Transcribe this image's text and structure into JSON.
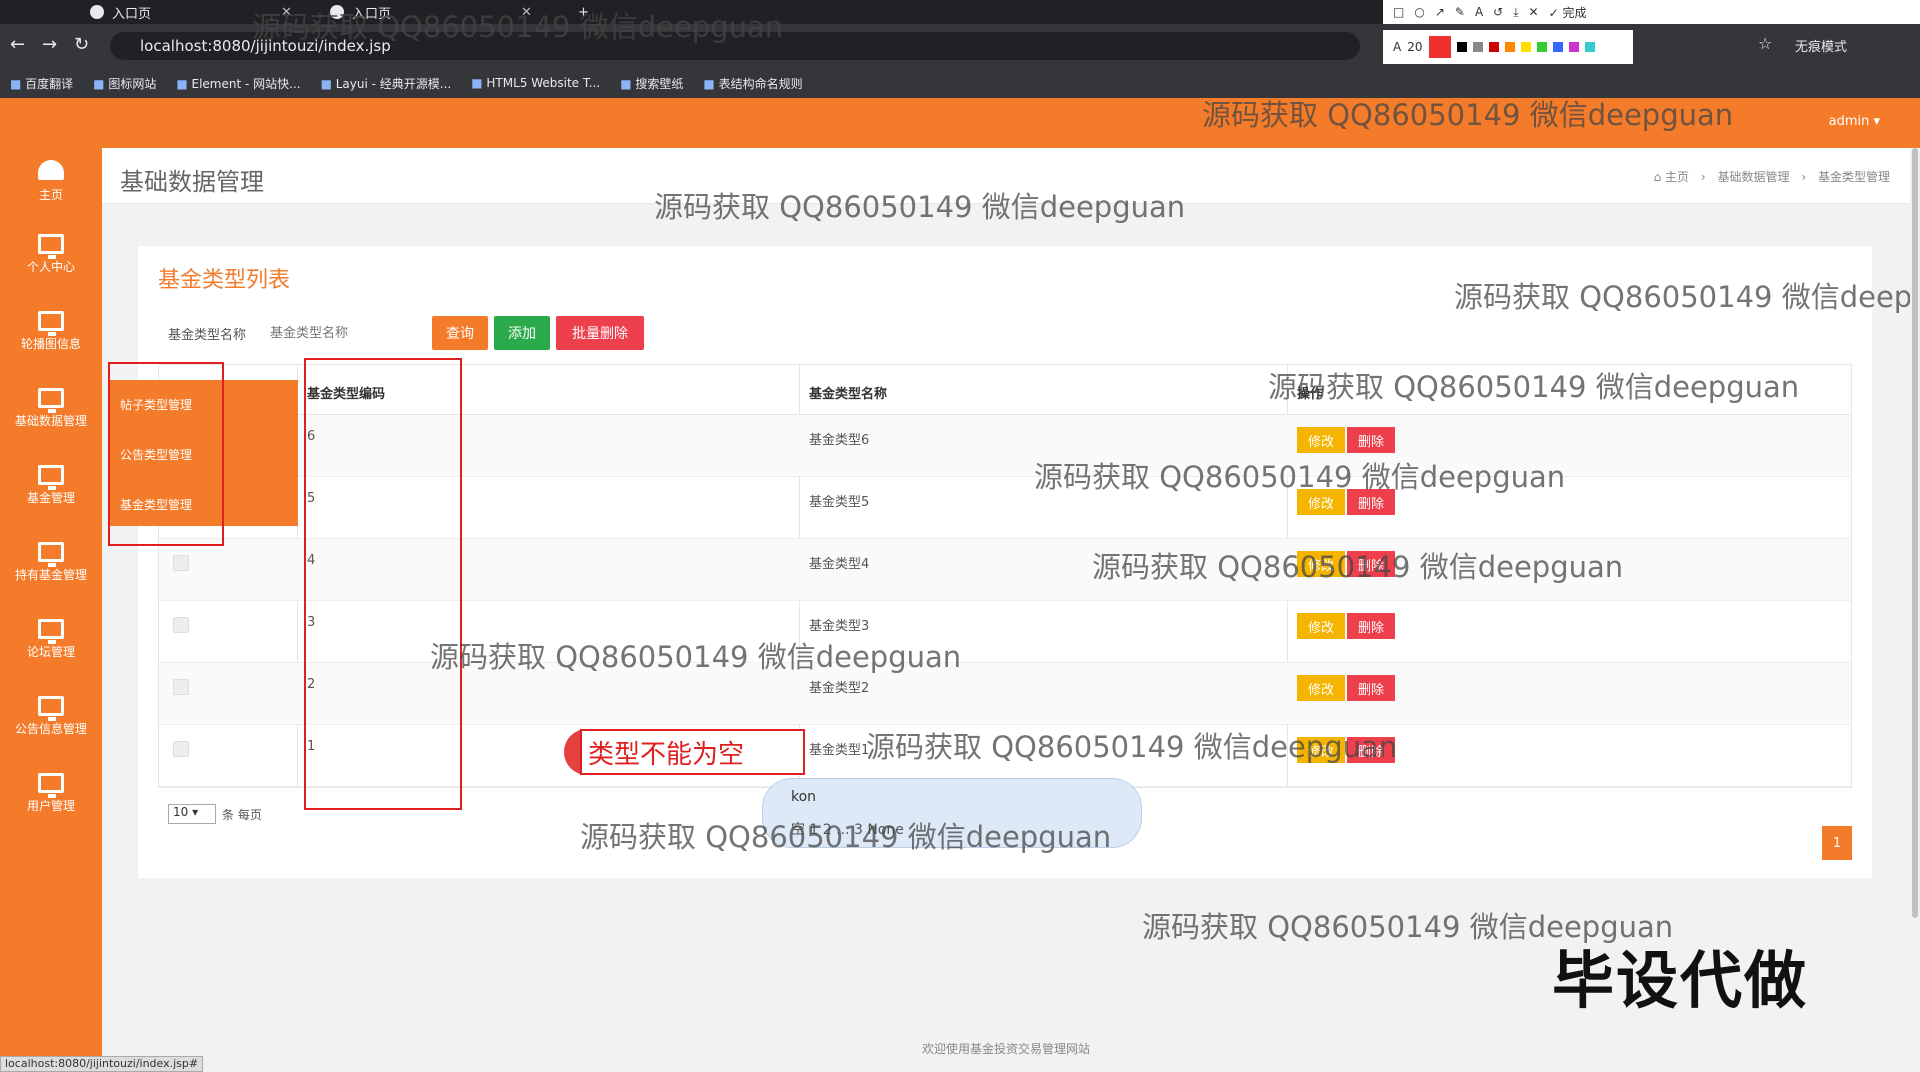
{
  "browser": {
    "tabs": [
      {
        "label": "入口页"
      },
      {
        "label": "入口页"
      }
    ],
    "url": "localhost:8080/jijintouzi/index.jsp",
    "incognito_label": "无痕模式",
    "done_label": "完成",
    "font_size_value": "20",
    "bookmarks": [
      "百度翻译",
      "图标网站",
      "Element - 网站快...",
      "Layui - 经典开源模...",
      "HTML5 Website T...",
      "搜索壁纸",
      "表结构命名规则"
    ],
    "status_url": "localhost:8080/jijintouzi/index.jsp#"
  },
  "header": {
    "user": "admin ▾"
  },
  "sidebar": {
    "items": [
      {
        "label": "主页",
        "icon": "dashboard-icon"
      },
      {
        "label": "个人中心",
        "icon": "monitor-icon"
      },
      {
        "label": "轮播图信息",
        "icon": "monitor-icon"
      },
      {
        "label": "基础数据管理",
        "icon": "monitor-icon"
      },
      {
        "label": "基金管理",
        "icon": "monitor-icon"
      },
      {
        "label": "持有基金管理",
        "icon": "monitor-icon"
      },
      {
        "label": "论坛管理",
        "icon": "monitor-icon"
      },
      {
        "label": "公告信息管理",
        "icon": "monitor-icon"
      },
      {
        "label": "用户管理",
        "icon": "monitor-icon"
      }
    ],
    "submenu": [
      "帖子类型管理",
      "公告类型管理",
      "基金类型管理"
    ]
  },
  "page": {
    "title": "基础数据管理",
    "breadcrumb": [
      "主页",
      "基础数据管理",
      "基金类型管理"
    ],
    "breadcrumb_sep": "›"
  },
  "card": {
    "title": "基金类型列表",
    "search_label": "基金类型名称",
    "search_placeholder": "基金类型名称",
    "buttons": {
      "query": "查询",
      "add": "添加",
      "batch_delete": "批量删除"
    }
  },
  "table": {
    "headers": [
      "基金类型编码",
      "基金类型名称",
      "操作"
    ],
    "rows": [
      {
        "code": "6",
        "name": "基金类型6"
      },
      {
        "code": "5",
        "name": "基金类型5"
      },
      {
        "code": "4",
        "name": "基金类型4"
      },
      {
        "code": "3",
        "name": "基金类型3"
      },
      {
        "code": "2",
        "name": "基金类型2"
      },
      {
        "code": "1",
        "name": "基金类型1"
      }
    ],
    "edit_label": "修改",
    "delete_label": "删除"
  },
  "pagination": {
    "page_size": "10",
    "page_size_label": "条 每页",
    "current_page": "1"
  },
  "annotation": {
    "error_text": "类型不能为空"
  },
  "ime": {
    "input": "kon",
    "candidates": "空 1 2 ... 3 None"
  },
  "footer": "欢迎使用基金投资交易管理网站",
  "watermark": "源码获取 QQ86050149 微信deepguan",
  "big_watermark": "毕设代做",
  "colors": {
    "accent": "#f47b2a",
    "danger": "#ee3f4d",
    "success": "#2aaa4a",
    "warning": "#f5b400"
  }
}
